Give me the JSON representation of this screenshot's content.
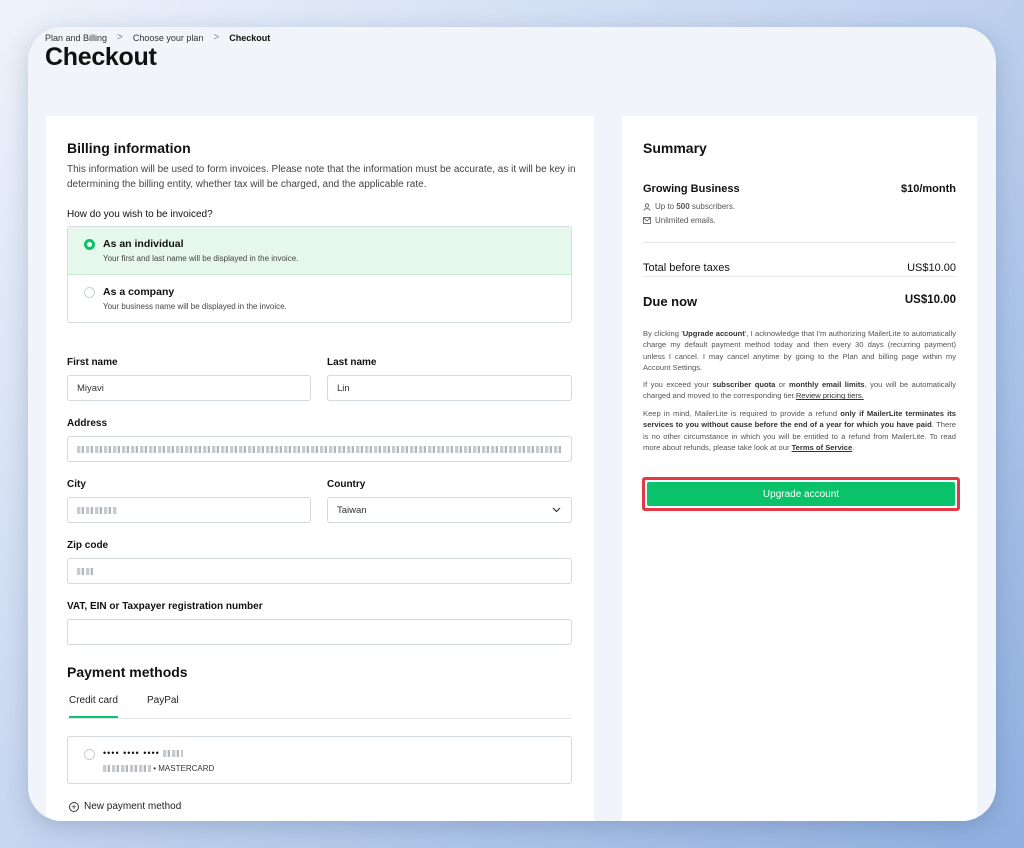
{
  "breadcrumb": {
    "items": [
      "Plan and Billing",
      "Choose your plan",
      "Checkout"
    ],
    "separator": ">"
  },
  "page": {
    "title": "Checkout"
  },
  "billing": {
    "title": "Billing information",
    "description": "This information will be used to form invoices. Please note that the information must be accurate, as it will be key in determining the billing entity, whether tax will be charged, and the applicable rate.",
    "invoice_question": "How do you wish to be invoiced?",
    "options": [
      {
        "title": "As an individual",
        "desc": "Your first and last name will be displayed in the invoice.",
        "selected": true
      },
      {
        "title": "As a company",
        "desc": "Your business name will be displayed in the invoice.",
        "selected": false
      }
    ],
    "fields": {
      "first_name": {
        "label": "First name",
        "value": "Miyavi"
      },
      "last_name": {
        "label": "Last name",
        "value": "Lin"
      },
      "address": {
        "label": "Address"
      },
      "city": {
        "label": "City"
      },
      "country": {
        "label": "Country",
        "value": "Taiwan"
      },
      "zip": {
        "label": "Zip code"
      },
      "vat": {
        "label": "VAT, EIN or Taxpayer registration number",
        "value": ""
      }
    }
  },
  "payment": {
    "title": "Payment methods",
    "tabs": [
      "Credit card",
      "PayPal"
    ],
    "card": {
      "masked": "•••• •••• ••••",
      "brand": "• MASTERCARD"
    },
    "new_method": "New payment method"
  },
  "summary": {
    "title": "Summary",
    "plan_name": "Growing Business",
    "plan_price": "$10/month",
    "subscribers_prefix": "Up to ",
    "subscribers_count": "500",
    "subscribers_suffix": " subscribers.",
    "emails": "Unlimited emails.",
    "total_label": "Total before taxes",
    "total_value": "US$10.00",
    "due_label": "Due now",
    "due_value": "US$10.00",
    "legal1": {
      "a": "By clicking '",
      "b": "Upgrade account",
      "c": "', I acknowledge that I'm authorizing MailerLite to automatically charge my default payment method today and then every 30 days (recurring payment) unless I cancel. I may cancel anytime by going to the Plan and billing page within my Account Settings."
    },
    "legal2": {
      "a": "If you exceed your ",
      "b": "subscriber quota",
      "c": " or ",
      "d": "monthly email limits",
      "e": ", you will be automatically charged and moved to the corresponding tier.",
      "link": "Review pricing tiers."
    },
    "legal3": {
      "a": "Keep in mind, MailerLite is required to provide a refund ",
      "b": "only if MailerLite terminates its services to you without cause before the end of a year for which you have paid",
      "c": ". There is no other circumstance in which you will be entitled to a refund from MailerLite. To read more about refunds, please take look at our ",
      "link": "Terms of Service",
      "d": "."
    },
    "cta": "Upgrade account"
  },
  "colors": {
    "accent": "#09c269",
    "highlight": "#e53845"
  }
}
